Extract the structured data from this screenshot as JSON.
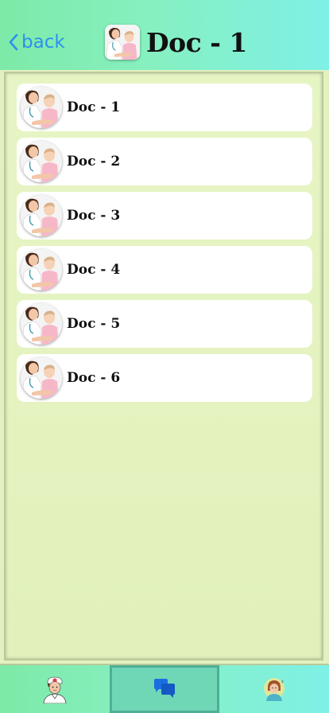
{
  "header": {
    "back_label": "back",
    "title": "Doc - 1",
    "avatar_icon": "mother-baby-doctor-avatar"
  },
  "doctors": [
    {
      "label": "Doc - 1"
    },
    {
      "label": "Doc - 2"
    },
    {
      "label": "Doc - 3"
    },
    {
      "label": "Doc - 4"
    },
    {
      "label": "Doc - 5"
    },
    {
      "label": "Doc - 6"
    }
  ],
  "tabbar": {
    "tabs": [
      {
        "icon": "nurse-icon"
      },
      {
        "icon": "chat-icon",
        "active": true
      },
      {
        "icon": "user-profile-icon"
      }
    ]
  },
  "colors": {
    "header_gradient_start": "#7deaa8",
    "header_gradient_end": "#7ff0e6",
    "back_link": "#2f8ff0",
    "panel_background": "#e3f0bf",
    "chat_icon": "#1a6fe0"
  }
}
